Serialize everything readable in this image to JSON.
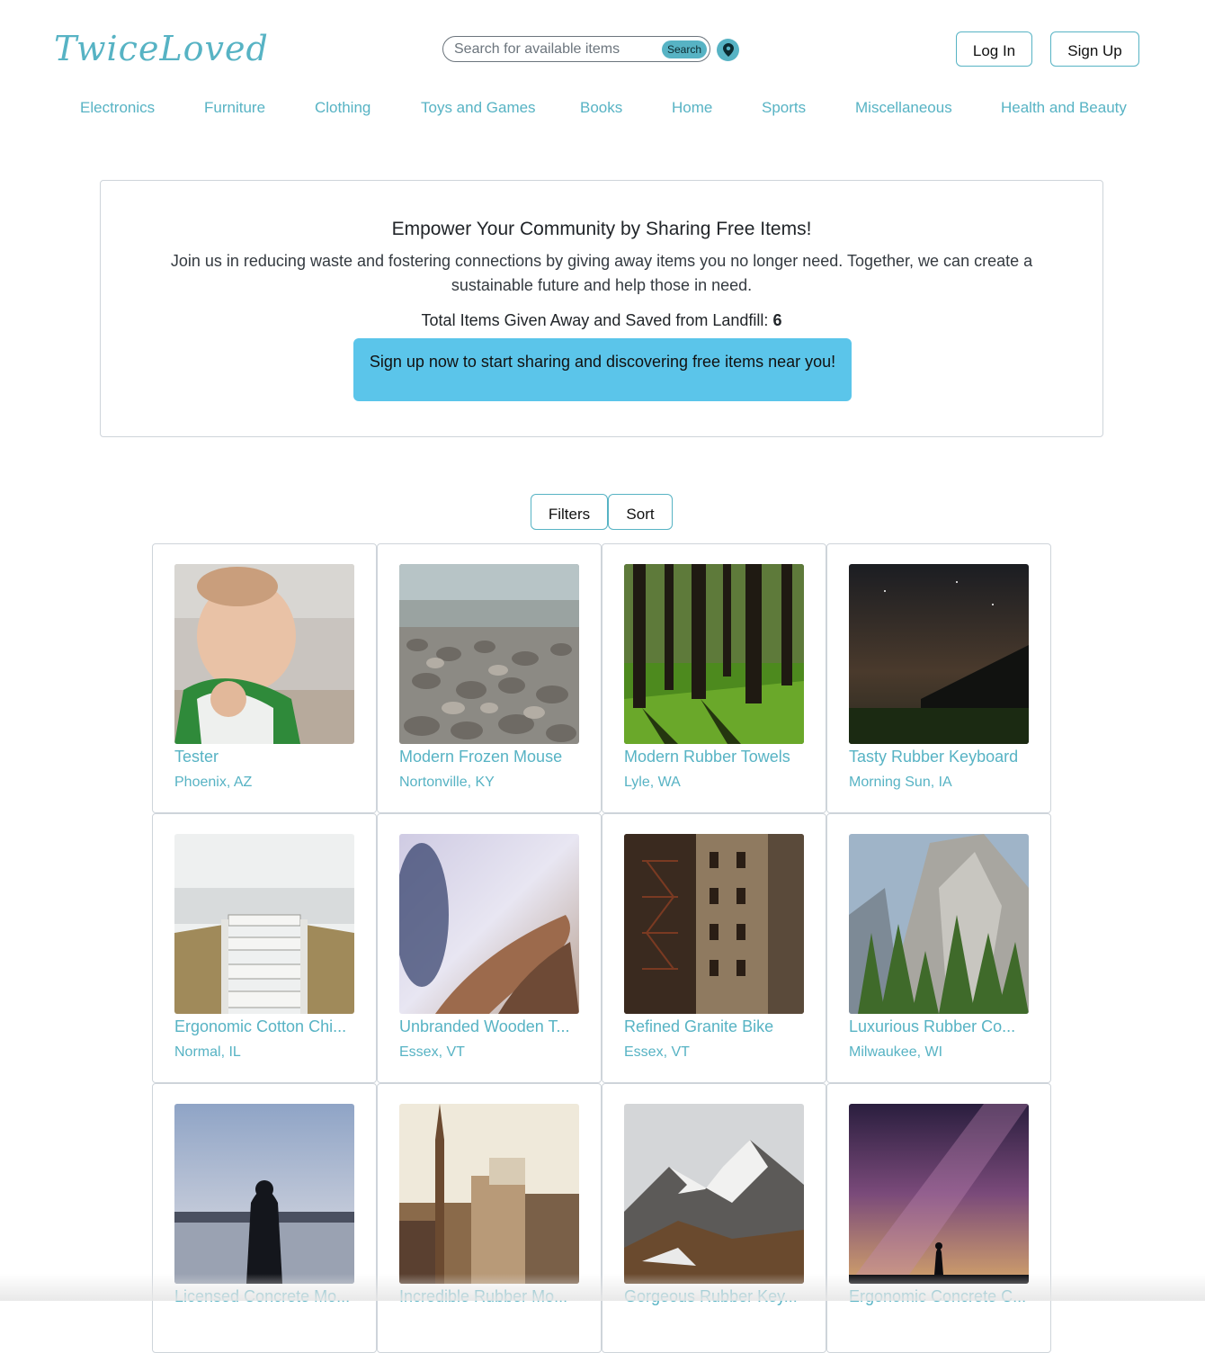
{
  "header": {
    "logo_text": "TwiceLoved",
    "search_placeholder": "Search for available items",
    "search_button": "Search",
    "login_label": "Log In",
    "signup_label": "Sign Up"
  },
  "nav": {
    "items": [
      "Electronics",
      "Furniture",
      "Clothing",
      "Toys and Games",
      "Books",
      "Home",
      "Sports",
      "Miscellaneous",
      "Health and Beauty"
    ]
  },
  "hero": {
    "title": "Empower Your Community by Sharing Free Items!",
    "description": "Join us in reducing waste and fostering connections by giving away items you no longer need. Together, we can create a sustainable future and help those in need.",
    "stat_label": "Total Items Given Away and Saved from Landfill:",
    "stat_value": "6",
    "cta": "Sign up now to start sharing and discovering free items near you!"
  },
  "controls": {
    "filters_label": "Filters",
    "sort_label": "Sort"
  },
  "listings": [
    {
      "title": "Tester",
      "location": "Phoenix, AZ"
    },
    {
      "title": "Modern Frozen Mouse",
      "location": "Nortonville, KY"
    },
    {
      "title": "Modern Rubber Towels",
      "location": "Lyle, WA"
    },
    {
      "title": "Tasty Rubber Keyboard",
      "location": "Morning Sun, IA"
    },
    {
      "title": "Ergonomic Cotton Chi...",
      "location": "Normal, IL"
    },
    {
      "title": "Unbranded Wooden T...",
      "location": "Essex, VT"
    },
    {
      "title": "Refined Granite Bike",
      "location": "Essex, VT"
    },
    {
      "title": "Luxurious Rubber Co...",
      "location": "Milwaukee, WI"
    },
    {
      "title": "Licensed Concrete Mo...",
      "location": ""
    },
    {
      "title": "Incredible Rubber Mo...",
      "location": ""
    },
    {
      "title": "Gorgeous Rubber Key...",
      "location": ""
    },
    {
      "title": "Ergonomic Concrete C...",
      "location": ""
    }
  ],
  "colors": {
    "brand": "#57b3c4",
    "cta": "#5bc5ea"
  }
}
